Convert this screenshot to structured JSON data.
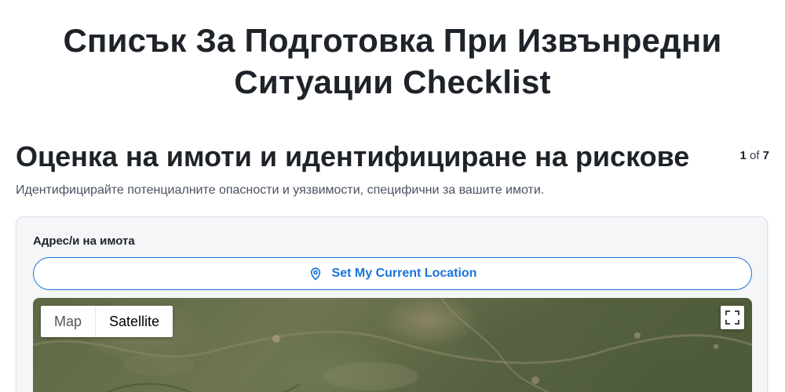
{
  "page": {
    "title": "Списък За Подготовка При Извънредни Ситуации Checklist"
  },
  "section": {
    "title": "Оценка на имоти и идентифициране на рискове",
    "description": "Идентифицирайте потенциалните опасности и уязвимости, специфични за вашите имоти.",
    "step_current": "1",
    "step_of": "of",
    "step_total": "7"
  },
  "form": {
    "address_label": "Адрес/и на имота",
    "location_button_label": "Set My Current Location",
    "location_icon": "map-pin-icon"
  },
  "map": {
    "type_options": [
      "Map",
      "Satellite"
    ],
    "selected_type": "Satellite",
    "fullscreen_icon": "fullscreen-icon"
  },
  "colors": {
    "accent": "#1a73d9",
    "heading": "#1e2329",
    "card_background": "#f5f6f8"
  }
}
